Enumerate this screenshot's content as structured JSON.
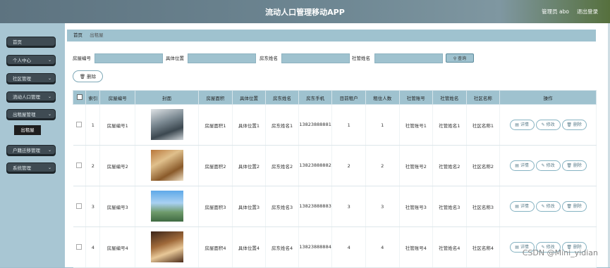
{
  "header": {
    "title": "流动人口管理移动APP",
    "admin": "管理员 abo",
    "logout": "退出登录"
  },
  "sidebar": {
    "items": [
      {
        "label": "首页",
        "chevron": false
      },
      {
        "label": "个人中心",
        "chevron": true
      },
      {
        "label": "社区管理",
        "chevron": true
      },
      {
        "label": "流动人口管理",
        "chevron": true
      },
      {
        "label": "出租屋管理",
        "chevron": true
      },
      {
        "label": "户籍迁移管理",
        "chevron": true
      },
      {
        "label": "系统管理",
        "chevron": true
      }
    ],
    "submenu": "出租屋"
  },
  "breadcrumb": {
    "home": "首页",
    "current": "出租屋"
  },
  "search": {
    "fields": [
      {
        "label": "房屋编号",
        "value": ""
      },
      {
        "label": "具体位置",
        "value": ""
      },
      {
        "label": "房东姓名",
        "value": ""
      },
      {
        "label": "社管姓名",
        "value": ""
      }
    ],
    "button": "查询"
  },
  "toolbar": {
    "delete": "删除"
  },
  "table": {
    "columns": [
      "索引",
      "房屋编号",
      "封面",
      "房屋面积",
      "具体位置",
      "房东姓名",
      "房东手机",
      "目前租户",
      "租住人数",
      "社管账号",
      "社管姓名",
      "社区名称",
      "操作"
    ],
    "rows": [
      {
        "index": "1",
        "code": "房屋编号1",
        "area": "房屋面积1",
        "location": "具体位置1",
        "owner": "房东姓名1",
        "phone": "13823888881",
        "tenants": "1",
        "count": "1",
        "account": "社管账号1",
        "manager": "社管姓名1",
        "community": "社区名称1"
      },
      {
        "index": "2",
        "code": "房屋编号2",
        "area": "房屋面积2",
        "location": "具体位置2",
        "owner": "房东姓名2",
        "phone": "13823888882",
        "tenants": "2",
        "count": "2",
        "account": "社管账号2",
        "manager": "社管姓名2",
        "community": "社区名称2"
      },
      {
        "index": "3",
        "code": "房屋编号3",
        "area": "房屋面积3",
        "location": "具体位置3",
        "owner": "房东姓名3",
        "phone": "13823888883",
        "tenants": "3",
        "count": "3",
        "account": "社管账号3",
        "manager": "社管姓名3",
        "community": "社区名称3"
      },
      {
        "index": "4",
        "code": "房屋编号4",
        "area": "房屋面积4",
        "location": "具体位置4",
        "owner": "房东姓名4",
        "phone": "13823888884",
        "tenants": "4",
        "count": "4",
        "account": "社管账号4",
        "manager": "社管姓名4",
        "community": "社区名称4"
      }
    ],
    "actions": {
      "detail": "详情",
      "edit": "修改",
      "remove": "删除"
    }
  },
  "icons": {
    "search": "search-icon",
    "delete": "trash-icon",
    "detail": "document-icon",
    "edit": "pencil-icon",
    "remove": "trash-icon",
    "chevron": "chevron-down-icon"
  },
  "watermark": "CSDN @Mini_yidian",
  "colors": {
    "topbar": "#6e8793",
    "sidebar": "#a8c6d3",
    "menu": "#3f4b53",
    "header_cell": "#9fc2cf",
    "accent": "#86b3c2"
  }
}
